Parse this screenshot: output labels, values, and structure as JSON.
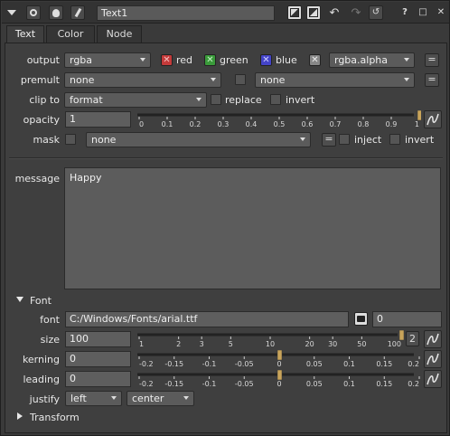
{
  "node_name": "Text1",
  "tabs": [
    "Text",
    "Color",
    "Node"
  ],
  "output": {
    "label": "output",
    "value": "rgba",
    "red": "red",
    "green": "green",
    "blue": "blue",
    "alpha_value": "rgba.alpha",
    "eq": "="
  },
  "premult": {
    "label": "premult",
    "value": "none",
    "value2": "none",
    "eq": "="
  },
  "clip_to": {
    "label": "clip to",
    "value": "format",
    "replace": "replace",
    "invert": "invert"
  },
  "opacity": {
    "label": "opacity",
    "value": "1",
    "ticks": [
      "0",
      "0.1",
      "0.2",
      "0.3",
      "0.4",
      "0.5",
      "0.6",
      "0.7",
      "0.8",
      "0.9",
      "1"
    ],
    "level": 1
  },
  "mask": {
    "label": "mask",
    "value": "none",
    "eq": "=",
    "inject": "inject",
    "invert": "invert"
  },
  "message": {
    "label": "message",
    "value": "Happy"
  },
  "font_section": {
    "label": "Font"
  },
  "font": {
    "label": "font",
    "path": "C:/Windows/Fonts/arial.ttf",
    "index": "0"
  },
  "size": {
    "label": "size",
    "value": "100",
    "ticks": [
      "1",
      "2",
      "3",
      "5",
      "10",
      "20",
      "30",
      "50",
      "100"
    ],
    "channels": "2",
    "level": 100
  },
  "kerning": {
    "label": "kerning",
    "value": "0",
    "ticks": [
      "-0.2",
      "-0.15",
      "-0.1",
      "-0.05",
      "0",
      "0.05",
      "0.1",
      "0.15",
      "0.2"
    ],
    "level": 0
  },
  "leading": {
    "label": "leading",
    "value": "0",
    "ticks": [
      "-0.2",
      "-0.15",
      "-0.1",
      "-0.05",
      "0",
      "0.05",
      "0.1",
      "0.15",
      "0.2"
    ],
    "level": 0
  },
  "justify": {
    "label": "justify",
    "horizontal": "left",
    "vertical": "center"
  },
  "transform_section": {
    "label": "Transform"
  },
  "colors": {
    "red": "#c43a3a",
    "green": "#3a9a3a",
    "blue": "#4444c8",
    "alpha": "#888888",
    "handle": "#c9a45a"
  }
}
